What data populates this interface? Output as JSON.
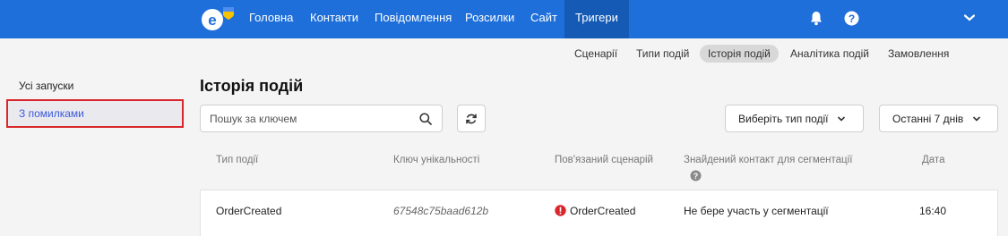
{
  "nav": {
    "items": [
      {
        "label": "Головна"
      },
      {
        "label": "Контакти"
      },
      {
        "label": "Повідомлення"
      },
      {
        "label": "Розсилки"
      },
      {
        "label": "Сайт"
      },
      {
        "label": "Тригери"
      }
    ],
    "active_index": 5,
    "icons": [
      "bell-icon",
      "help-circle-icon",
      "chevron-down-icon"
    ],
    "brand_color": "#1e6fd9",
    "active_color": "#155bb6"
  },
  "subnav": {
    "items": [
      {
        "label": "Сценарії"
      },
      {
        "label": "Типи подій"
      },
      {
        "label": "Історія подій"
      },
      {
        "label": "Аналітика подій"
      },
      {
        "label": "Замовлення"
      }
    ],
    "active_index": 2
  },
  "sidebar": {
    "items": [
      {
        "label": "Усі запуски"
      },
      {
        "label": "З помилками"
      }
    ],
    "selected_index": 1
  },
  "main": {
    "title": "Історія подій",
    "search": {
      "placeholder": "Пошук за ключем",
      "value": ""
    },
    "event_type_dropdown": {
      "label": "Виберіть тип події"
    },
    "period_dropdown": {
      "label": "Останні 7 днів"
    }
  },
  "table": {
    "columns": [
      "Тип події",
      "Ключ унікальності",
      "Пов'язаний сценарій",
      "Знайдений контакт для сегментації",
      "Дата"
    ],
    "rows": [
      {
        "event_type": "OrderCreated",
        "unique_key": "67548c75baad612b",
        "scenario": "OrderCreated",
        "scenario_status": "error",
        "contact": "Не бере участь у сегментації",
        "date": "16:40"
      }
    ]
  },
  "colors": {
    "error": "#d9262c",
    "selected_text": "#3b5bdb"
  }
}
